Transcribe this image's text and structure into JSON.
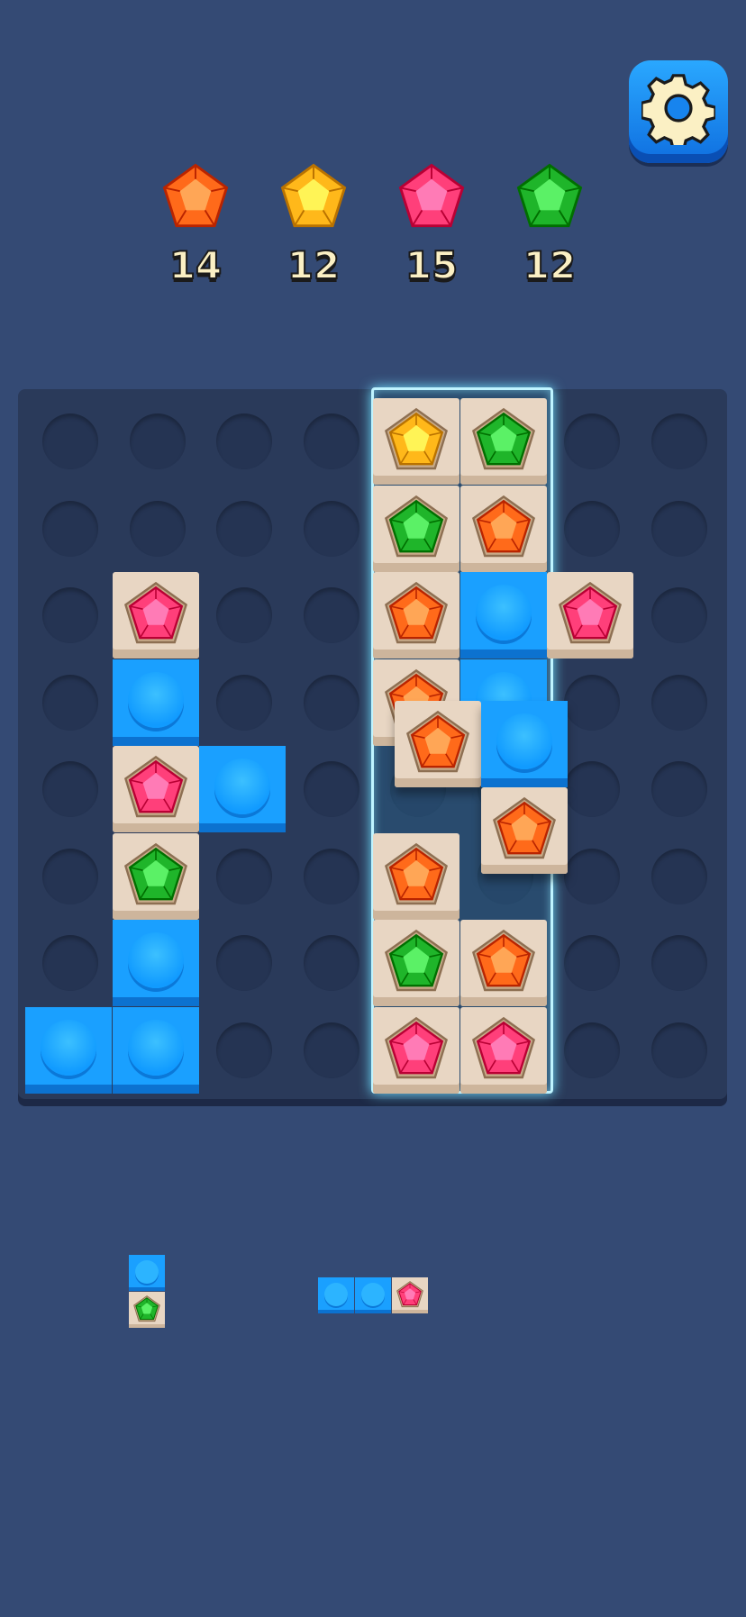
{
  "colors": {
    "background": "#344a74",
    "board": "#2a3a5a",
    "blue_block": "#1aa0ff",
    "cream_tile": "#e8d6c3",
    "gem_orange": "#ff6a1a",
    "gem_yellow": "#ffb81a",
    "gem_pink": "#ff3f7a",
    "gem_green": "#1fb52a"
  },
  "settings": {
    "icon": "gear-icon"
  },
  "goals": [
    {
      "gem": "orange",
      "count": "14"
    },
    {
      "gem": "yellow",
      "count": "12"
    },
    {
      "gem": "pink",
      "count": "15"
    },
    {
      "gem": "green",
      "count": "12"
    }
  ],
  "board": {
    "cols": 8,
    "rows": 8,
    "highlighted_columns": [
      4,
      5
    ],
    "cells": [
      {
        "row": 0,
        "col": 4,
        "type": "gem",
        "gem": "yellow"
      },
      {
        "row": 0,
        "col": 5,
        "type": "gem",
        "gem": "green"
      },
      {
        "row": 1,
        "col": 4,
        "type": "gem",
        "gem": "green"
      },
      {
        "row": 1,
        "col": 5,
        "type": "gem",
        "gem": "orange"
      },
      {
        "row": 2,
        "col": 1,
        "type": "gem",
        "gem": "pink"
      },
      {
        "row": 2,
        "col": 4,
        "type": "gem",
        "gem": "orange"
      },
      {
        "row": 2,
        "col": 5,
        "type": "block"
      },
      {
        "row": 2,
        "col": 6,
        "type": "gem",
        "gem": "pink"
      },
      {
        "row": 3,
        "col": 1,
        "type": "block"
      },
      {
        "row": 3,
        "col": 4,
        "type": "gem",
        "gem": "orange"
      },
      {
        "row": 3,
        "col": 5,
        "type": "block"
      },
      {
        "row": 4,
        "col": 1,
        "type": "gem",
        "gem": "pink"
      },
      {
        "row": 4,
        "col": 2,
        "type": "block"
      },
      {
        "row": 5,
        "col": 1,
        "type": "gem",
        "gem": "green"
      },
      {
        "row": 5,
        "col": 4,
        "type": "gem",
        "gem": "orange"
      },
      {
        "row": 6,
        "col": 1,
        "type": "block"
      },
      {
        "row": 6,
        "col": 4,
        "type": "gem",
        "gem": "green"
      },
      {
        "row": 6,
        "col": 5,
        "type": "gem",
        "gem": "orange"
      },
      {
        "row": 7,
        "col": 0,
        "type": "block"
      },
      {
        "row": 7,
        "col": 1,
        "type": "block"
      },
      {
        "row": 7,
        "col": 4,
        "type": "gem",
        "gem": "pink"
      },
      {
        "row": 7,
        "col": 5,
        "type": "gem",
        "gem": "pink"
      }
    ],
    "dragged_piece": [
      {
        "type": "gem",
        "gem": "orange"
      },
      {
        "type": "block"
      },
      {
        "type": "gem",
        "gem": "orange"
      }
    ]
  },
  "tray": [
    {
      "name": "tray-piece-1",
      "cells": [
        {
          "type": "block"
        },
        {
          "type": "gem",
          "gem": "green"
        }
      ],
      "orientation": "vertical"
    },
    {
      "name": "tray-piece-2",
      "cells": [
        {
          "type": "block"
        },
        {
          "type": "block"
        },
        {
          "type": "gem",
          "gem": "pink"
        }
      ],
      "orientation": "horizontal"
    }
  ]
}
